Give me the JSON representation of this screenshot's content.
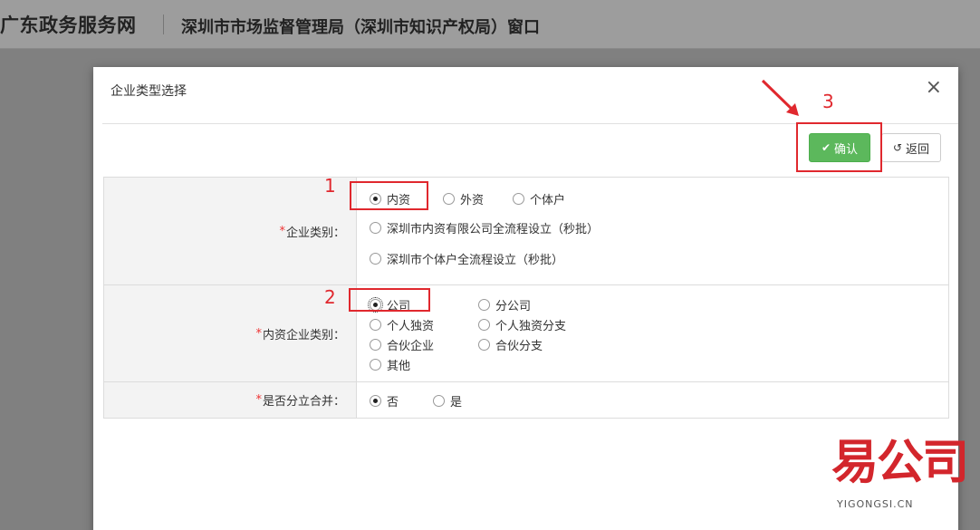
{
  "site": {
    "title": "广东政务服务网",
    "subtitle": "深圳市市场监督管理局（深圳市知识产权局）窗口"
  },
  "dialog": {
    "title": "企业类型选择",
    "close": "×",
    "confirm_label": "确认",
    "back_label": "返回"
  },
  "form": {
    "enterprise_type": {
      "label": "企业类别：",
      "required_mark": "*",
      "options": [
        "内资",
        "外资",
        "个体户",
        "深圳市内资有限公司全流程设立（秒批）",
        "深圳市个体户全流程设立（秒批）"
      ],
      "selected": "内资"
    },
    "domestic_type": {
      "label": "内资企业类别：",
      "required_mark": "*",
      "options": [
        "公司",
        "分公司",
        "个人独资",
        "个人独资分支",
        "合伙企业",
        "合伙分支",
        "其他"
      ],
      "selected": "公司"
    },
    "split_merge": {
      "label": "是否分立合并：",
      "required_mark": "*",
      "options": [
        "否",
        "是"
      ],
      "selected": "否"
    }
  },
  "annotations": [
    "1",
    "2",
    "3"
  ],
  "watermark": {
    "brand": "易公司",
    "url": "YIGONGSI.CN"
  },
  "colors": {
    "confirm": "#5cb85c",
    "annotation": "#e0282e",
    "required": "#ee3333"
  }
}
